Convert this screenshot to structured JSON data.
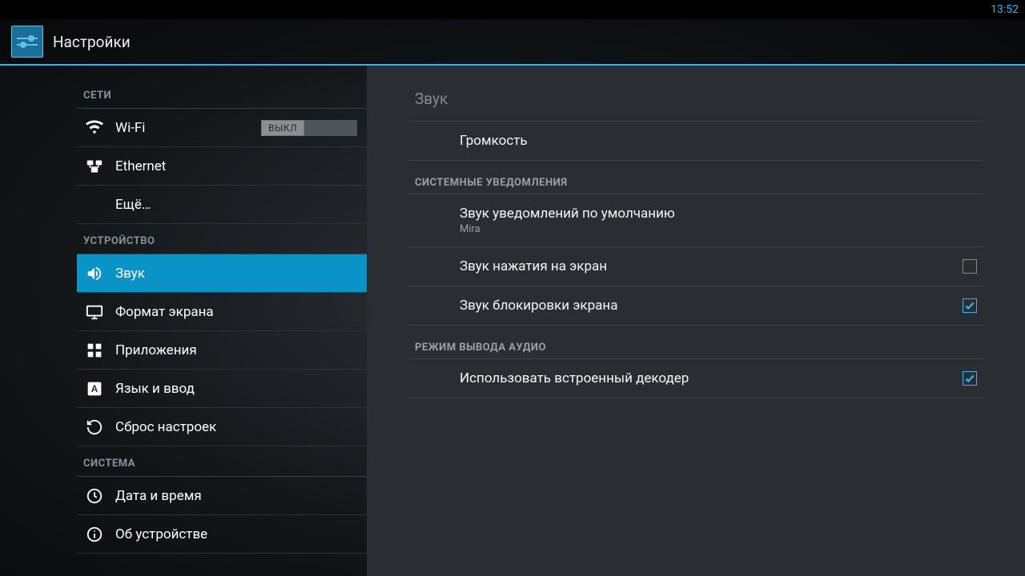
{
  "statusBar": {
    "time": "13:52"
  },
  "actionBar": {
    "title": "Настройки"
  },
  "sidebar": {
    "cat_networks": "СЕТИ",
    "item_wifi": {
      "label": "Wi-Fi",
      "toggle": "ВЫКЛ"
    },
    "item_ethernet": {
      "label": "Ethernet"
    },
    "item_more": {
      "label": "Ещё…"
    },
    "cat_device": "УСТРОЙСТВО",
    "item_sound": {
      "label": "Звук"
    },
    "item_display": {
      "label": "Формат экрана"
    },
    "item_apps": {
      "label": "Приложения"
    },
    "item_language": {
      "label": "Язык и ввод"
    },
    "item_reset": {
      "label": "Сброс настроек"
    },
    "cat_system": "СИСТЕМА",
    "item_datetime": {
      "label": "Дата и время"
    },
    "item_about": {
      "label": "Об устройстве"
    }
  },
  "detail": {
    "title": "Звук",
    "item_volume": {
      "label": "Громкость"
    },
    "cat_notifications": "СИСТЕМНЫЕ УВЕДОМЛЕНИЯ",
    "item_default_notif": {
      "label": "Звук уведомлений по умолчанию",
      "value": "Mira"
    },
    "item_touch_sounds": {
      "label": "Звук нажатия на экран",
      "checked": false
    },
    "item_lock_sound": {
      "label": "Звук блокировки экрана",
      "checked": true
    },
    "cat_audio_out": "РЕЖИМ ВЫВОДА АУДИО",
    "item_builtin_decoder": {
      "label": "Использовать встроенный декодер",
      "checked": true
    }
  }
}
